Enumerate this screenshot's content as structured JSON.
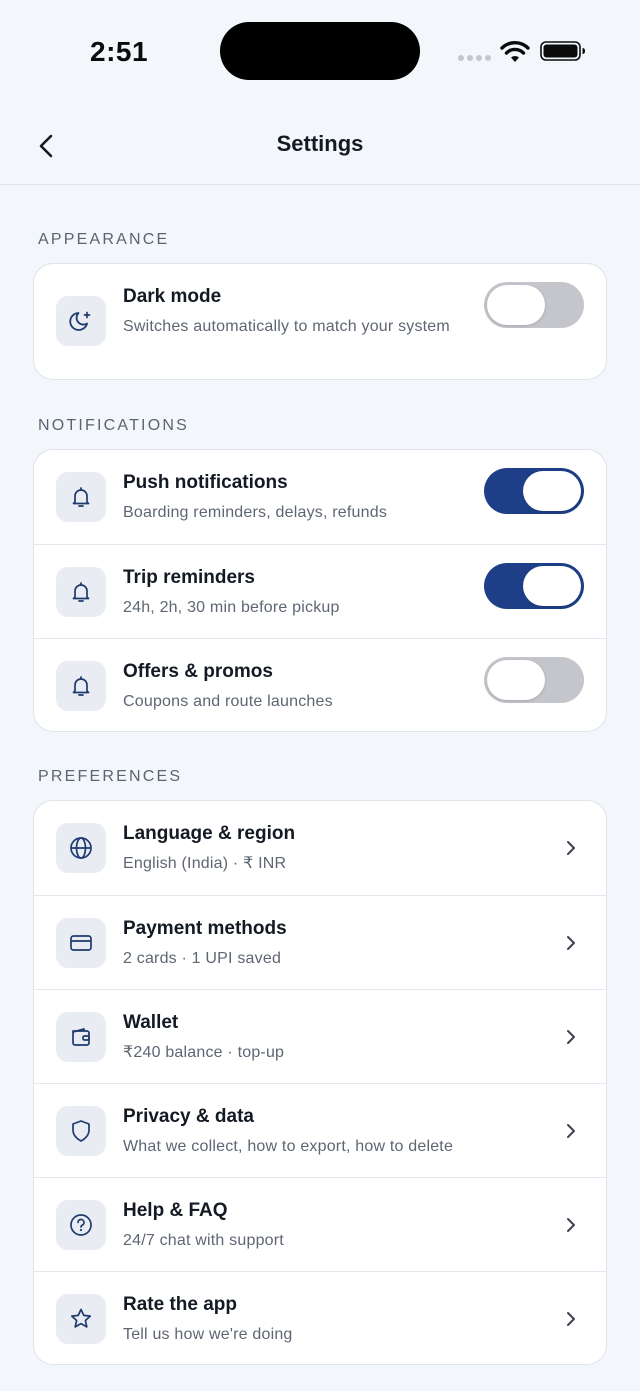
{
  "status_bar": {
    "time": "2:51"
  },
  "nav": {
    "title": "Settings"
  },
  "sections": {
    "appearance": {
      "label": "APPEARANCE",
      "dark_mode": {
        "title": "Dark mode",
        "subtitle": "Switches automatically to match your system",
        "enabled": false,
        "icon": "moon-icon"
      }
    },
    "notifications": {
      "label": "NOTIFICATIONS",
      "items": [
        {
          "title": "Push notifications",
          "subtitle": "Boarding reminders, delays, refunds",
          "enabled": true,
          "icon": "bell-icon"
        },
        {
          "title": "Trip reminders",
          "subtitle": "24h, 2h, 30 min before pickup",
          "enabled": true,
          "icon": "bell-icon"
        },
        {
          "title": "Offers & promos",
          "subtitle": "Coupons and route launches",
          "enabled": false,
          "icon": "bell-icon"
        }
      ]
    },
    "preferences": {
      "label": "PREFERENCES",
      "items": [
        {
          "title": "Language & region",
          "subtitle": "English (India) · ₹ INR",
          "icon": "globe-icon"
        },
        {
          "title": "Payment methods",
          "subtitle": "2 cards · 1 UPI saved",
          "icon": "card-icon"
        },
        {
          "title": "Wallet",
          "subtitle": "₹240 balance · top-up",
          "icon": "wallet-icon"
        },
        {
          "title": "Privacy & data",
          "subtitle": "What we collect, how to export, how to delete",
          "icon": "shield-icon"
        },
        {
          "title": "Help & FAQ",
          "subtitle": "24/7 chat with support",
          "icon": "help-icon"
        },
        {
          "title": "Rate the app",
          "subtitle": "Tell us how we're doing",
          "icon": "star-icon"
        }
      ]
    }
  },
  "colors": {
    "background": "#f3f7fc",
    "toggle_on": "#1e3f87",
    "toggle_off": "#c4c6cb",
    "icon_stroke": "#1f3a6e"
  }
}
